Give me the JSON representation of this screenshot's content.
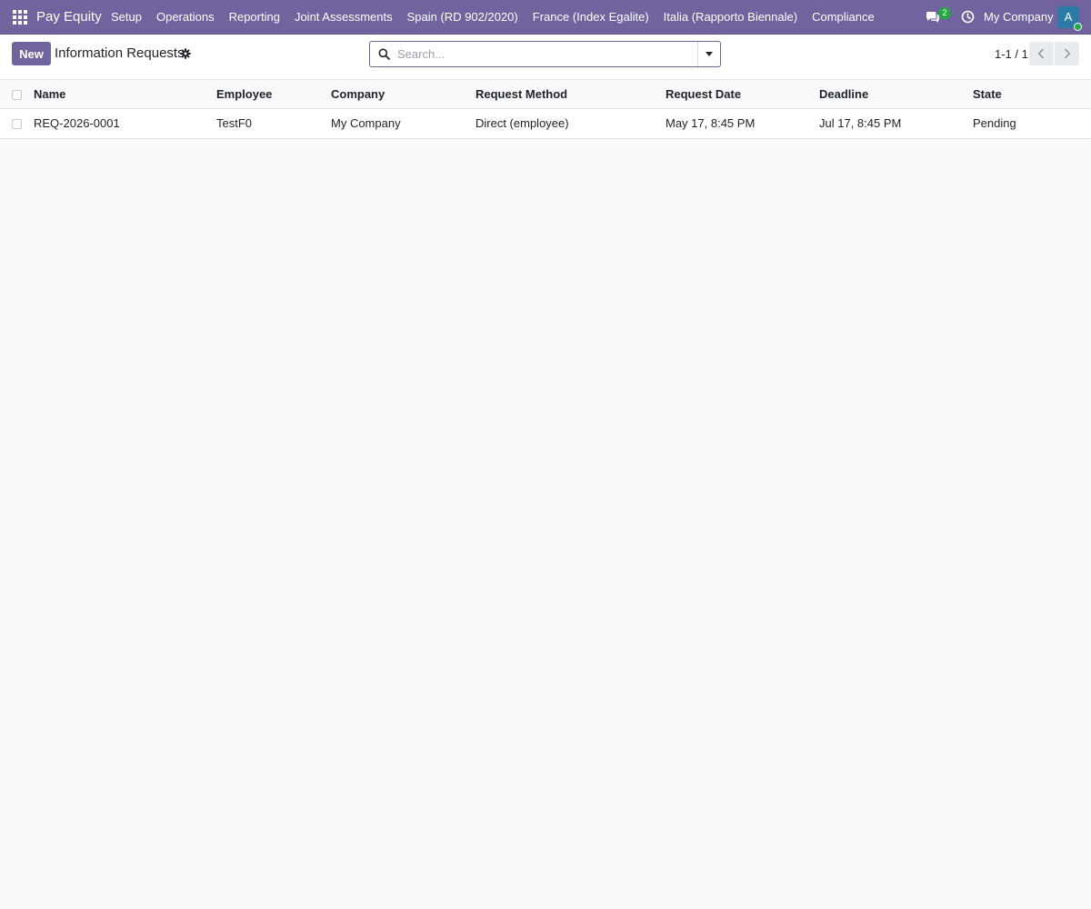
{
  "navbar": {
    "app_name": "Pay Equity",
    "menu": [
      {
        "label": "Setup"
      },
      {
        "label": "Operations"
      },
      {
        "label": "Reporting"
      },
      {
        "label": "Joint Assessments"
      },
      {
        "label": "Spain (RD 902/2020)"
      },
      {
        "label": "France (Index Egalite)"
      },
      {
        "label": "Italia (Rapporto Biennale)"
      },
      {
        "label": "Compliance"
      }
    ],
    "messages_count": "2",
    "company": "My Company",
    "avatar_initial": "A",
    "colors": {
      "bar": "#71639e",
      "badge": "#28a745",
      "avatar": "#2c7aa8"
    }
  },
  "control_panel": {
    "new_label": "New",
    "title": "Information Requests",
    "search_placeholder": "Search...",
    "pager": "1-1 / 1"
  },
  "table": {
    "columns": [
      "Name",
      "Employee",
      "Company",
      "Request Method",
      "Request Date",
      "Deadline",
      "State"
    ],
    "rows": [
      {
        "name": "REQ-2026-0001",
        "employee": "TestF0",
        "company": "My Company",
        "request_method": "Direct (employee)",
        "request_date": "May 17, 8:45 PM",
        "deadline": "Jul 17, 8:45 PM",
        "state": "Pending"
      }
    ]
  }
}
